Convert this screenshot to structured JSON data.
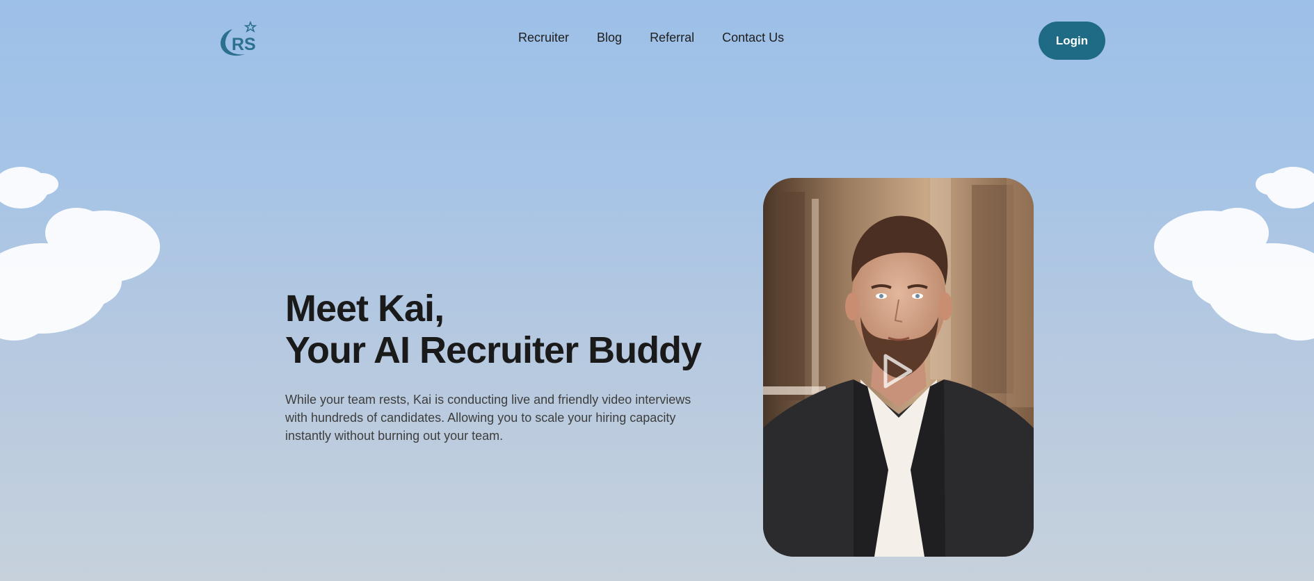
{
  "header": {
    "logo_text": "RS",
    "nav": [
      {
        "label": "Recruiter"
      },
      {
        "label": "Blog"
      },
      {
        "label": "Referral"
      },
      {
        "label": "Contact Us"
      }
    ],
    "login_label": "Login"
  },
  "hero": {
    "title_line1": "Meet Kai,",
    "title_line2": "Your AI Recruiter Buddy",
    "description": "While your team rests, Kai is conducting live and friendly video interviews with hundreds of candidates. Allowing you to scale your hiring capacity instantly without burning out your team."
  },
  "icons": {
    "logo": "rs-logo-icon",
    "play": "play-icon"
  },
  "colors": {
    "accent": "#1f6a84",
    "logo": "#2c6f8f",
    "background_top": "#9dc0e8",
    "background_bottom": "#c6d1dc",
    "text_dark": "#1a1a1a"
  }
}
